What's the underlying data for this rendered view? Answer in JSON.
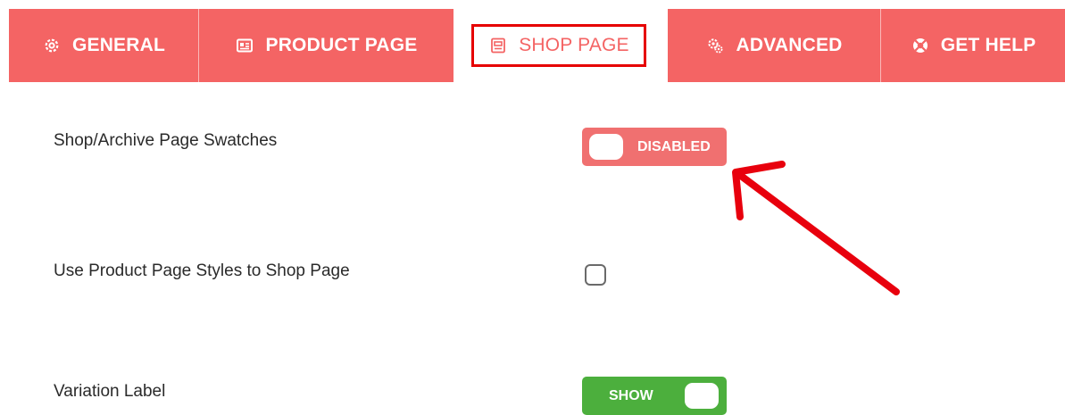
{
  "tabs": {
    "general": {
      "label": "GENERAL",
      "icon": "gear-icon"
    },
    "product_page": {
      "label": "PRODUCT PAGE",
      "icon": "product-card-icon"
    },
    "shop_page": {
      "label": "SHOP PAGE",
      "icon": "document-icon",
      "active": true
    },
    "advanced": {
      "label": "ADVANCED",
      "icon": "gears-icon"
    },
    "get_help": {
      "label": "GET HELP",
      "icon": "lifebuoy-icon"
    }
  },
  "settings": {
    "shop_swatches": {
      "label": "Shop/Archive Page Swatches",
      "toggle_text": "DISABLED",
      "state": "off"
    },
    "product_styles": {
      "label": "Use Product Page Styles to Shop Page",
      "checked": false
    },
    "variation_label": {
      "label": "Variation Label",
      "toggle_text": "SHOW",
      "state": "on"
    }
  },
  "colors": {
    "tab_bar": "#f46464",
    "active_outline": "#e60000",
    "toggle_off": "#f07070",
    "toggle_on": "#4caf3d",
    "annotation_arrow": "#e8000d"
  }
}
